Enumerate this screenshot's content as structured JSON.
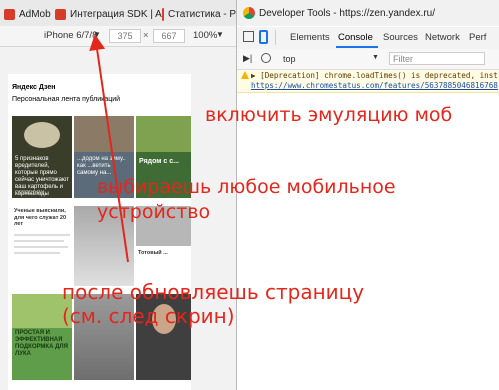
{
  "tabs": [
    {
      "label": "AdMob",
      "icon": "admob-icon"
    },
    {
      "label": "Интеграция SDK | A",
      "icon": "admob-icon"
    },
    {
      "label": "Статистика - Р",
      "icon": "metrika-icon"
    }
  ],
  "emulation": {
    "device": "iPhone 6/7/8",
    "width": "375",
    "separator": "×",
    "height": "667",
    "zoom": "100%"
  },
  "devtools": {
    "window_title": "Developer Tools - https://zen.yandex.ru/",
    "tabs": [
      "Elements",
      "Console",
      "Sources",
      "Network",
      "Perf"
    ],
    "active_tab": "Console",
    "context": "top",
    "filter_placeholder": "Filter",
    "message_line1": "▶ [Deprecation] chrome.loadTimes() is deprecated, inst",
    "message_line2": "https://www.chromestatus.com/features/5637885046816768"
  },
  "page": {
    "logo": "Яндекс Дзен",
    "subtitle": "Персональная лента публикаций",
    "cards": [
      {
        "caption": "5 признаков вредителей, которые прямо сейчас уничтожают ваш картофель и корнеплоды",
        "source": "ОГОРОД.RU"
      },
      {
        "caption": "...додом на зиму.. как ...ветить самому на...",
        "source": ""
      },
      {
        "caption": "Рядом с с...",
        "source": ""
      },
      {
        "caption": "Ученые выяснили, для чего служат 20 лет",
        "source": ""
      },
      {
        "caption": "Тотовый ...",
        "source": ""
      },
      {
        "caption": "ПРОСТАЯ И ЭФФЕКТИВНАЯ ПОДКОРМКА ДЛЯ ЛУКА",
        "source": ""
      }
    ]
  },
  "annotations": {
    "emulation": "включить эмуляцию моб",
    "device": "выбираешь любое мобильное",
    "device2": "устройство",
    "refresh": "после обновляешь страницу",
    "refresh2": "(см. след скрин)"
  },
  "colors": {
    "annotation": "#e4271c",
    "accent": "#1a73e8",
    "tabbar": "#e9e9e9"
  }
}
